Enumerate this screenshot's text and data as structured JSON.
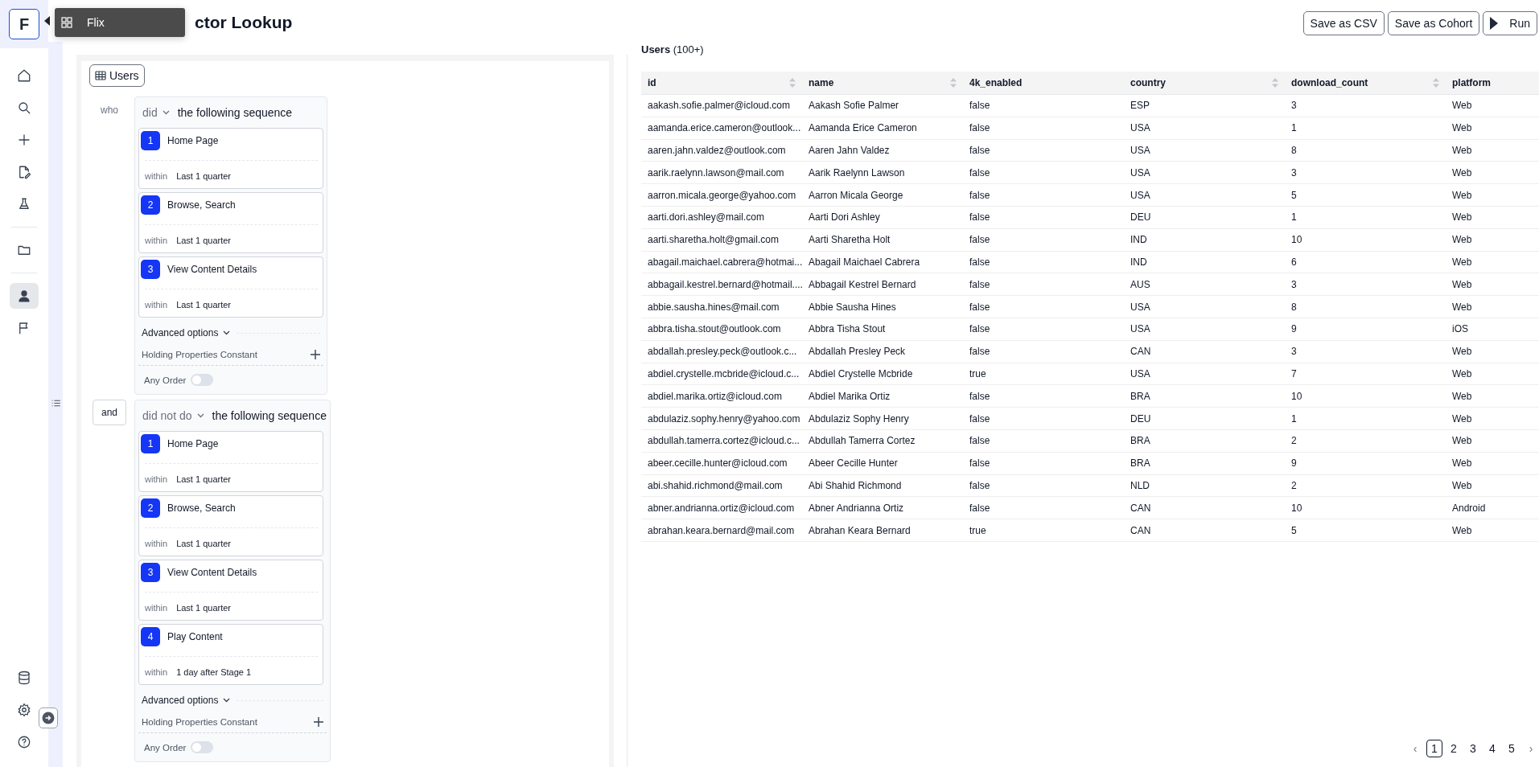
{
  "logo": "F",
  "tooltip": {
    "label": "Flix"
  },
  "nav": [
    {
      "selected": false
    },
    {
      "selected": false
    },
    {
      "selected": false
    },
    {
      "selected": false
    },
    {
      "selected": false
    },
    {
      "selected": false
    },
    {
      "selected": true
    },
    {
      "selected": false
    }
  ],
  "title": "ctor Lookup",
  "actions": [
    {
      "label": "Save as CSV",
      "kind": "text"
    },
    {
      "label": "Save as Cohort",
      "kind": "text"
    },
    {
      "label": "Run",
      "kind": "run"
    }
  ],
  "entity": "Users",
  "sequences": [
    {
      "connector": {
        "kind": "label",
        "text": "who"
      },
      "mode": "did",
      "text": "the following sequence",
      "steps": [
        {
          "number": "1",
          "event": "Home Page",
          "within_label": "within",
          "within": "Last 1 quarter"
        },
        {
          "number": "2",
          "event": "Browse, Search",
          "within_label": "within",
          "within": "Last 1 quarter"
        },
        {
          "number": "3",
          "event": "View Content Details",
          "within_label": "within",
          "within": "Last 1 quarter"
        }
      ],
      "advanced": "Advanced options",
      "holding": "Holding Properties Constant",
      "any_order": {
        "label": "Any Order",
        "on": false
      }
    },
    {
      "connector": {
        "kind": "button",
        "text": "and"
      },
      "mode": "did not do",
      "text": "the following sequence",
      "steps": [
        {
          "number": "1",
          "event": "Home Page",
          "within_label": "within",
          "within": "Last 1 quarter"
        },
        {
          "number": "2",
          "event": "Browse, Search",
          "within_label": "within",
          "within": "Last 1 quarter"
        },
        {
          "number": "3",
          "event": "View Content Details",
          "within_label": "within",
          "within": "Last 1 quarter"
        },
        {
          "number": "4",
          "event": "Play Content",
          "within_label": "within",
          "within": "1 day after Stage 1"
        }
      ],
      "advanced": "Advanced options",
      "holding": "Holding Properties Constant",
      "any_order": {
        "label": "Any Order",
        "on": false
      }
    }
  ],
  "results": {
    "heading": "**Users** (100+)",
    "columns": [
      {
        "label": "id",
        "sortable": true
      },
      {
        "label": "name",
        "sortable": true
      },
      {
        "label": "4k_enabled",
        "sortable": false
      },
      {
        "label": "country",
        "sortable": true
      },
      {
        "label": "download_count",
        "sortable": true
      },
      {
        "label": "platform",
        "sortable": false
      }
    ],
    "rows": [
      [
        "aakash.sofie.palmer@icloud.com",
        "Aakash Sofie Palmer",
        "false",
        "ESP",
        "3",
        "Web"
      ],
      [
        "aamanda.erice.cameron@outlook...",
        "Aamanda Erice Cameron",
        "false",
        "USA",
        "1",
        "Web"
      ],
      [
        "aaren.jahn.valdez@outlook.com",
        "Aaren Jahn Valdez",
        "false",
        "USA",
        "8",
        "Web"
      ],
      [
        "aarik.raelynn.lawson@mail.com",
        "Aarik Raelynn Lawson",
        "false",
        "USA",
        "3",
        "Web"
      ],
      [
        "aarron.micala.george@yahoo.com",
        "Aarron Micala George",
        "false",
        "USA",
        "5",
        "Web"
      ],
      [
        "aarti.dori.ashley@mail.com",
        "Aarti Dori Ashley",
        "false",
        "DEU",
        "1",
        "Web"
      ],
      [
        "aarti.sharetha.holt@gmail.com",
        "Aarti Sharetha Holt",
        "false",
        "IND",
        "10",
        "Web"
      ],
      [
        "abagail.maichael.cabrera@hotmai...",
        "Abagail Maichael Cabrera",
        "false",
        "IND",
        "6",
        "Web"
      ],
      [
        "abbagail.kestrel.bernard@hotmail....",
        "Abbagail Kestrel Bernard",
        "false",
        "AUS",
        "3",
        "Web"
      ],
      [
        "abbie.sausha.hines@mail.com",
        "Abbie Sausha Hines",
        "false",
        "USA",
        "8",
        "Web"
      ],
      [
        "abbra.tisha.stout@outlook.com",
        "Abbra Tisha Stout",
        "false",
        "USA",
        "9",
        "iOS"
      ],
      [
        "abdallah.presley.peck@outlook.c...",
        "Abdallah Presley Peck",
        "false",
        "CAN",
        "3",
        "Web"
      ],
      [
        "abdiel.crystelle.mcbride@icloud.c...",
        "Abdiel Crystelle Mcbride",
        "true",
        "USA",
        "7",
        "Web"
      ],
      [
        "abdiel.marika.ortiz@icloud.com",
        "Abdiel Marika Ortiz",
        "false",
        "BRA",
        "10",
        "Web"
      ],
      [
        "abdulaziz.sophy.henry@yahoo.com",
        "Abdulaziz Sophy Henry",
        "false",
        "DEU",
        "1",
        "Web"
      ],
      [
        "abdullah.tamerra.cortez@icloud.c...",
        "Abdullah Tamerra Cortez",
        "false",
        "BRA",
        "2",
        "Web"
      ],
      [
        "abeer.cecille.hunter@icloud.com",
        "Abeer Cecille Hunter",
        "false",
        "BRA",
        "9",
        "Web"
      ],
      [
        "abi.shahid.richmond@mail.com",
        "Abi Shahid Richmond",
        "false",
        "NLD",
        "2",
        "Web"
      ],
      [
        "abner.andrianna.ortiz@icloud.com",
        "Abner Andrianna Ortiz",
        "false",
        "CAN",
        "10",
        "Android"
      ],
      [
        "abrahan.keara.bernard@mail.com",
        "Abrahan Keara Bernard",
        "true",
        "CAN",
        "5",
        "Web"
      ]
    ],
    "pagination": {
      "prev": "‹",
      "next": "›",
      "pages": [
        {
          "label": "1",
          "selected": true
        },
        {
          "label": "2",
          "selected": false
        },
        {
          "label": "3",
          "selected": false
        },
        {
          "label": "4",
          "selected": false
        },
        {
          "label": "5",
          "selected": false
        }
      ]
    }
  }
}
